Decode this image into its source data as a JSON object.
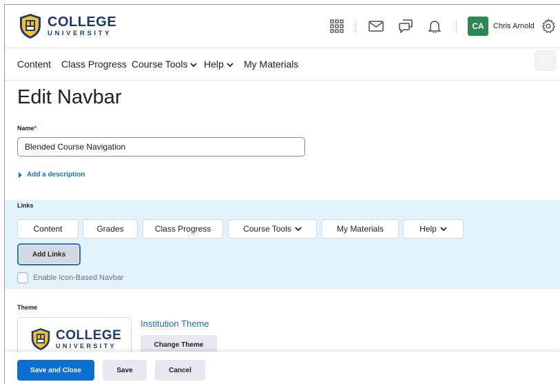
{
  "header": {
    "logo": {
      "line1": "COLLEGE",
      "line2": "UNIVERSITY"
    },
    "icons": [
      "waffle-icon",
      "mail-icon",
      "chat-icon",
      "bell-icon",
      "gear-icon"
    ],
    "user": {
      "initials": "CA",
      "name": "Chris Arnold",
      "avatar_color": "#2d8753"
    }
  },
  "navbar": {
    "items": [
      {
        "label": "Content"
      },
      {
        "label": "Class Progress"
      },
      {
        "label": "Course Tools"
      },
      {
        "label": "Help"
      },
      {
        "label": "My Materials"
      }
    ],
    "more_label": "···"
  },
  "page": {
    "title": "Edit Navbar"
  },
  "form": {
    "name_label": "Name",
    "required_mark": "*",
    "name_value": "Blended Course Navigation",
    "add_description": "Add a description",
    "links_label": "Links",
    "links": [
      {
        "label": "Content"
      },
      {
        "label": "Grades"
      },
      {
        "label": "Class Progress"
      },
      {
        "label": "Course Tools"
      },
      {
        "label": "My Materials"
      },
      {
        "label": "Help"
      }
    ],
    "add_links_label": "Add Links",
    "icon_navbar_label": "Enable Icon-Based Navbar",
    "theme_label": "Theme",
    "theme": {
      "logo_line1": "COLLEGE",
      "logo_line2": "UNIVERSITY",
      "name": "Institution Theme",
      "change_label": "Change Theme"
    }
  },
  "footer": {
    "save_close": "Save and Close",
    "save": "Save",
    "cancel": "Cancel"
  },
  "colors": {
    "accent": "#0b6fd0",
    "link": "#1a6fc6",
    "panel": "#e3f3fd"
  }
}
